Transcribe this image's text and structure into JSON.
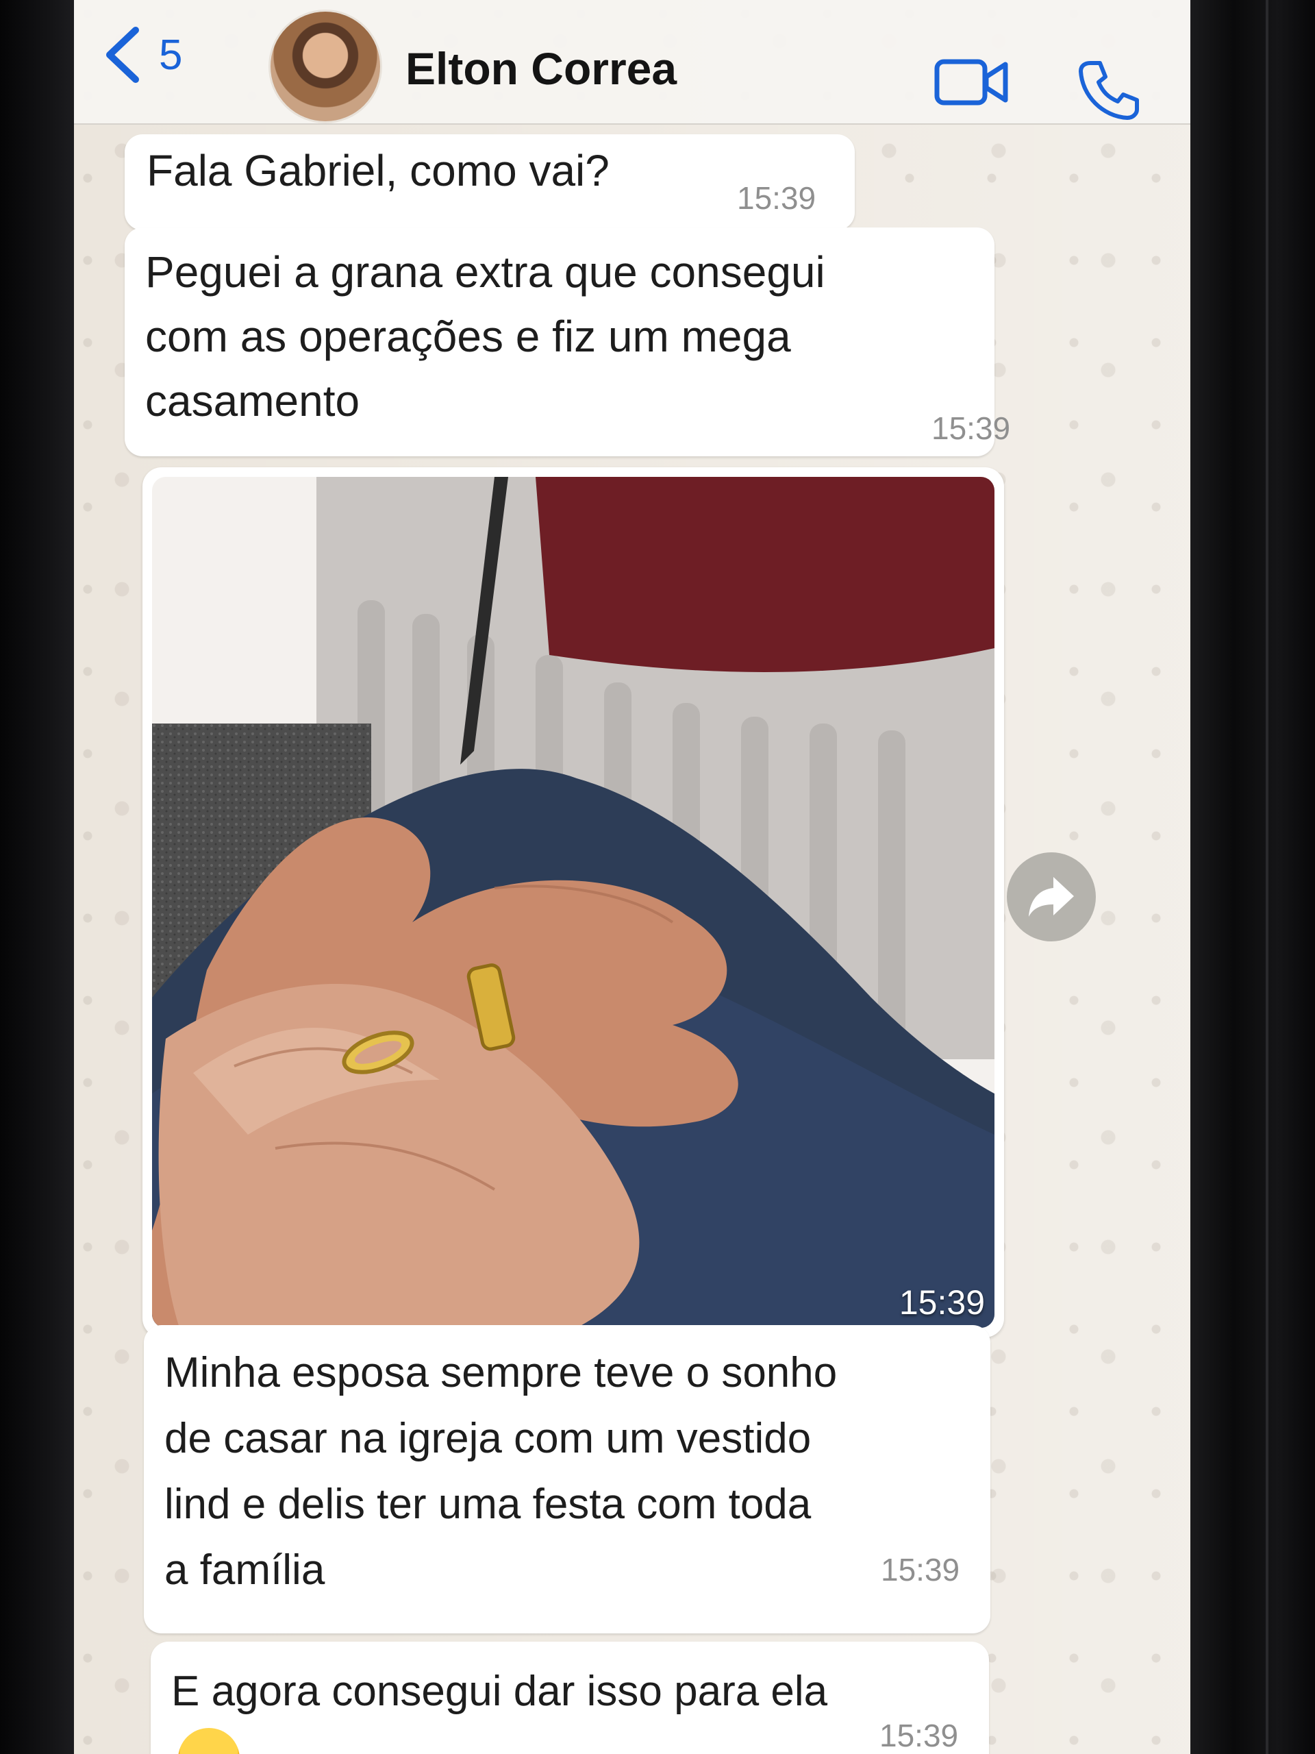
{
  "header": {
    "back_count": "5",
    "contact_name": "Elton Correa"
  },
  "messages": [
    {
      "text": "Fala Gabriel, como vai?",
      "time": "15:39"
    },
    {
      "text": "Peguei a grana extra que consegui\ncom as operações e fiz um mega\ncasamento",
      "time": "15:39"
    },
    {
      "type": "image",
      "description_icon": "photo-of-hands-with-rings",
      "time": "15:39"
    },
    {
      "text": "Minha esposa sempre teve o sonho\nde casar na igreja com um vestido\nlind e delis ter uma festa com toda\na família",
      "time": "15:39"
    },
    {
      "text": "E agora consegui dar isso para ela",
      "emoji": "😁",
      "time": "15:39"
    }
  ],
  "colors": {
    "accent": "#1a63d8",
    "bubble": "#ffffff",
    "chat_bg": "#ece6dd"
  },
  "icons": [
    "chevron-left-icon",
    "video-call-icon",
    "phone-call-icon",
    "forward-icon"
  ]
}
